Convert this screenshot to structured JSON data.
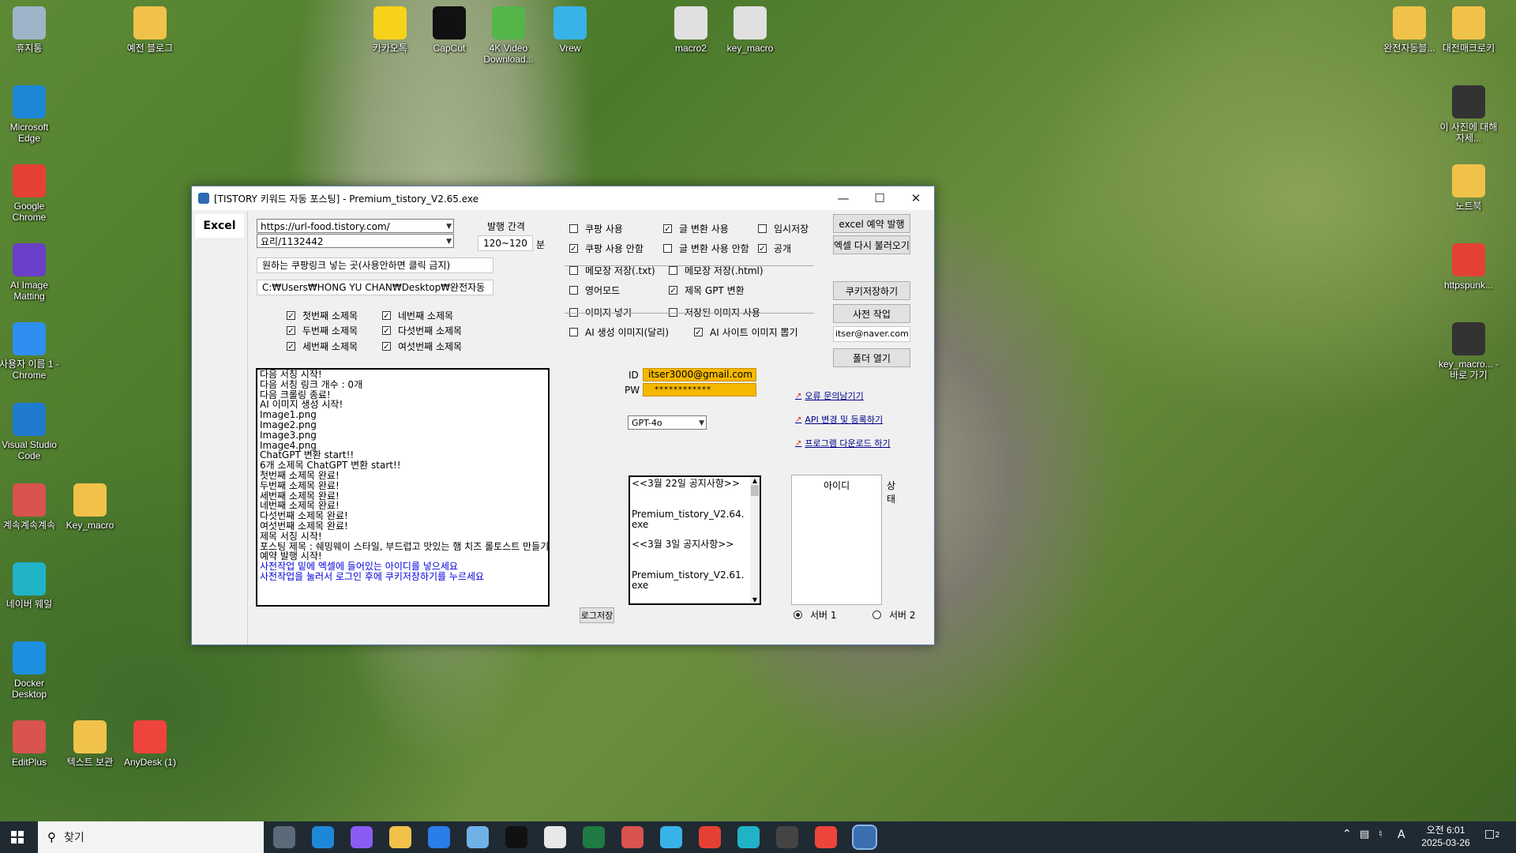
{
  "desktop": {
    "icons": [
      {
        "label": "휴지통",
        "name": "recycle-bin-icon",
        "color": "#9fb4c8"
      },
      {
        "label": "Microsoft Edge",
        "name": "edge-icon",
        "color": "#1e88d8"
      },
      {
        "label": "Google Chrome",
        "name": "chrome-icon",
        "color": "#e44134"
      },
      {
        "label": "AI Image Matting",
        "name": "ai-image-matting-icon",
        "color": "#6b3fc7"
      },
      {
        "label": "사용자 이름 1 - Chrome",
        "name": "chrome-profile-icon",
        "color": "#2f8ff0"
      },
      {
        "label": "Visual Studio Code",
        "name": "vscode-icon",
        "color": "#1f7ad0"
      },
      {
        "label": "계속계속계속",
        "name": "editplus-doc-icon",
        "color": "#d9534f"
      },
      {
        "label": "Key_macro",
        "name": "folder-icon",
        "color": "#f1c24a"
      },
      {
        "label": "네이버 웨일",
        "name": "whale-icon",
        "color": "#20b3c8"
      },
      {
        "label": "Docker Desktop",
        "name": "docker-icon",
        "color": "#1d8fe0"
      },
      {
        "label": "EditPlus",
        "name": "editplus-icon",
        "color": "#d9534f"
      },
      {
        "label": "텍스트 보관",
        "name": "folder-icon",
        "color": "#f1c24a"
      },
      {
        "label": "AnyDesk (1)",
        "name": "anydesk-icon",
        "color": "#ef443b"
      },
      {
        "label": "예전 블로그",
        "name": "folder-icon",
        "color": "#f1c24a"
      },
      {
        "label": "카카오톡",
        "name": "kakaotalk-icon",
        "color": "#f7d21b"
      },
      {
        "label": "CapCut",
        "name": "capcut-icon",
        "color": "#111111"
      },
      {
        "label": "4K Video Download...",
        "name": "4k-video-icon",
        "color": "#54b548"
      },
      {
        "label": "Vrew",
        "name": "vrew-icon",
        "color": "#38b3e8"
      },
      {
        "label": "macro2",
        "name": "text-file-icon",
        "color": "#e0e0e0"
      },
      {
        "label": "key_macro",
        "name": "settings-file-icon",
        "color": "#e0e0e0"
      },
      {
        "label": "완전자동블...",
        "name": "folder-icon",
        "color": "#f1c24a"
      },
      {
        "label": "대전매크로키",
        "name": "folder-icon",
        "color": "#f1c24a"
      },
      {
        "label": "이 사진에 대해 자세...",
        "name": "photo-info-icon",
        "color": "#333333"
      },
      {
        "label": "노트북",
        "name": "notebook-folder-icon",
        "color": "#f1c24a"
      },
      {
        "label": "httpspunk...",
        "name": "chrome-file-icon",
        "color": "#e44134"
      },
      {
        "label": "key_macro... - 바로 가기",
        "name": "keyboard-shortcut-icon",
        "color": "#333333"
      }
    ]
  },
  "window": {
    "title": "[TISTORY 키워드 자동 포스팅] - Premium_tistory_V2.65.exe",
    "tab": "Excel",
    "url_combo": "https://url-food.tistory.com/",
    "category_combo": "요리/1132442",
    "interval_label": "발행 간격",
    "interval_value": "120~120",
    "interval_unit": "분",
    "coupang_box": "원하는 쿠팡링크 넣는 곳(사용안하면 클릭 금지)",
    "path_box": "C:₩Users₩HONG YU CHAN₩Desktop₩완전자동",
    "subtitles": [
      {
        "label": "첫번째 소제목",
        "checked": true
      },
      {
        "label": "네번째 소제목",
        "checked": true
      },
      {
        "label": "두번째 소제목",
        "checked": true
      },
      {
        "label": "다섯번째 소제목",
        "checked": true
      },
      {
        "label": "세번째 소제목",
        "checked": true
      },
      {
        "label": "여섯번째 소제목",
        "checked": true
      }
    ],
    "options": [
      {
        "label": "쿠팡 사용",
        "checked": false
      },
      {
        "label": "글 변환 사용",
        "checked": true
      },
      {
        "label": "임시저장",
        "checked": false
      },
      {
        "label": "쿠팡 사용 안함",
        "checked": true
      },
      {
        "label": "글 변환 사용 안함",
        "checked": false
      },
      {
        "label": "공개",
        "checked": true
      },
      {
        "label": "메모장 저장(.txt)",
        "checked": false
      },
      {
        "label": "메모장 저장(.html)",
        "checked": false
      },
      {
        "label": "영어모드",
        "checked": false
      },
      {
        "label": "제목 GPT 변환",
        "checked": true
      },
      {
        "label": "이미지 넣기",
        "checked": false
      },
      {
        "label": "저장된 이미지 사용",
        "checked": false
      },
      {
        "label": "AI 생성 이미지(달리)",
        "checked": false
      },
      {
        "label": "AI 사이트 이미지 뽑기",
        "checked": true
      }
    ],
    "buttons": {
      "excel_schedule": "excel 예약 발행",
      "excel_reload": "엑셀 다시 불러오기",
      "cookie_save": "쿠키저장하기",
      "pre_work": "사전 작업",
      "folder_open": "폴더 열기",
      "log_save": "로그저장"
    },
    "email_box": "itser@naver.com",
    "id_label": "ID",
    "id_value": "itser3000@gmail.com",
    "pw_label": "PW",
    "pw_value": "************",
    "gpt_model": "GPT-4o",
    "links": [
      "오류 문의남기기",
      "API 변경 및 등록하기",
      "프로그램 다운로드 하기"
    ],
    "log_lines": [
      {
        "text": "다음 서칭 시작!",
        "blue": false
      },
      {
        "text": "다음 서칭 링크 개수 : 0개",
        "blue": false
      },
      {
        "text": "다음 크롤링 종료!",
        "blue": false
      },
      {
        "text": "AI 이미지 생성 시작!",
        "blue": false
      },
      {
        "text": "Image1.png",
        "blue": false
      },
      {
        "text": "Image2.png",
        "blue": false
      },
      {
        "text": "Image3.png",
        "blue": false
      },
      {
        "text": "Image4.png",
        "blue": false
      },
      {
        "text": "ChatGPT 변환 start!!",
        "blue": false
      },
      {
        "text": "6개 소제목 ChatGPT 변환 start!!",
        "blue": false
      },
      {
        "text": "첫번째 소제목 완료!",
        "blue": false
      },
      {
        "text": "두번째 소제목 완료!",
        "blue": false
      },
      {
        "text": "세번째 소제목 완료!",
        "blue": false
      },
      {
        "text": "네번째 소제목 완료!",
        "blue": false
      },
      {
        "text": "다섯번째 소제목 완료!",
        "blue": false
      },
      {
        "text": "여섯번째 소제목 완료!",
        "blue": false
      },
      {
        "text": "제목 서칭 시작!",
        "blue": false
      },
      {
        "text": "포스팅 제목 : 쉐밍웨이 스타일, 부드럽고 맛있는 햄 치즈 롤토스트 만들기",
        "blue": false
      },
      {
        "text": "예약 발행 시작!",
        "blue": false
      },
      {
        "text": "사전작업 밑에 엑셀에 들어있는 아이디를 넣으세요",
        "blue": true
      },
      {
        "text": "사전작업을 눌러서 로그인 후에 쿠키저장하기를 누르세요",
        "blue": true
      }
    ],
    "notices": [
      "<<3월 22일 공지사항>>",
      "Premium_tistory_V2.64.exe",
      "<<3월 3일 공지사항>>",
      "Premium_tistory_V2.61.exe"
    ],
    "table_headers": [
      "아이디",
      "상태"
    ],
    "servers": [
      {
        "label": "서버 1",
        "selected": true
      },
      {
        "label": "서버 2",
        "selected": false
      }
    ]
  },
  "taskbar": {
    "search_placeholder": "찾기",
    "clock_time": "오전 6:01",
    "clock_date": "2025-03-26",
    "ime": "A",
    "notif_count": "2"
  }
}
